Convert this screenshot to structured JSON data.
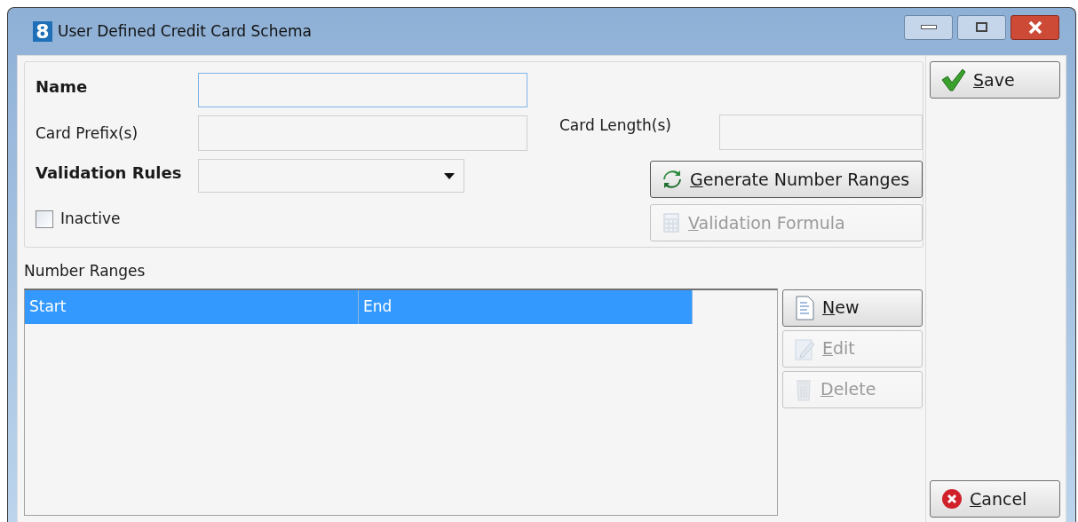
{
  "window": {
    "app_icon": "8",
    "title": "User Defined Credit Card Schema"
  },
  "fields": [
    {
      "kind": "text",
      "label": "Name",
      "required": true,
      "focused": true
    },
    {
      "kind": "text",
      "label": "Card Prefix(s)",
      "required": false,
      "focused": false
    },
    {
      "kind": "select",
      "label": "Validation Rules",
      "required": true,
      "focused": false
    }
  ],
  "side_field": {
    "label": "Card Length(s)",
    "required": false
  },
  "inactive": {
    "label": "Inactive",
    "checked": false
  },
  "form_buttons": [
    {
      "label": "Generate Number Ranges",
      "kind": "refresh",
      "disabled": false,
      "default": true
    },
    {
      "label": "Validation Formula",
      "kind": "calculator",
      "disabled": true,
      "default": false
    }
  ],
  "number_ranges": {
    "label": "Number Ranges",
    "columns": [
      "Start",
      "End"
    ]
  },
  "range_buttons": [
    {
      "label": "New",
      "kind": "document",
      "disabled": false
    },
    {
      "label": "Edit",
      "kind": "pencil",
      "disabled": true
    },
    {
      "label": "Delete",
      "kind": "trash",
      "disabled": true
    }
  ],
  "actions": [
    {
      "label": "Save",
      "kind": "check"
    },
    {
      "label": "Cancel",
      "kind": "cancel"
    }
  ]
}
